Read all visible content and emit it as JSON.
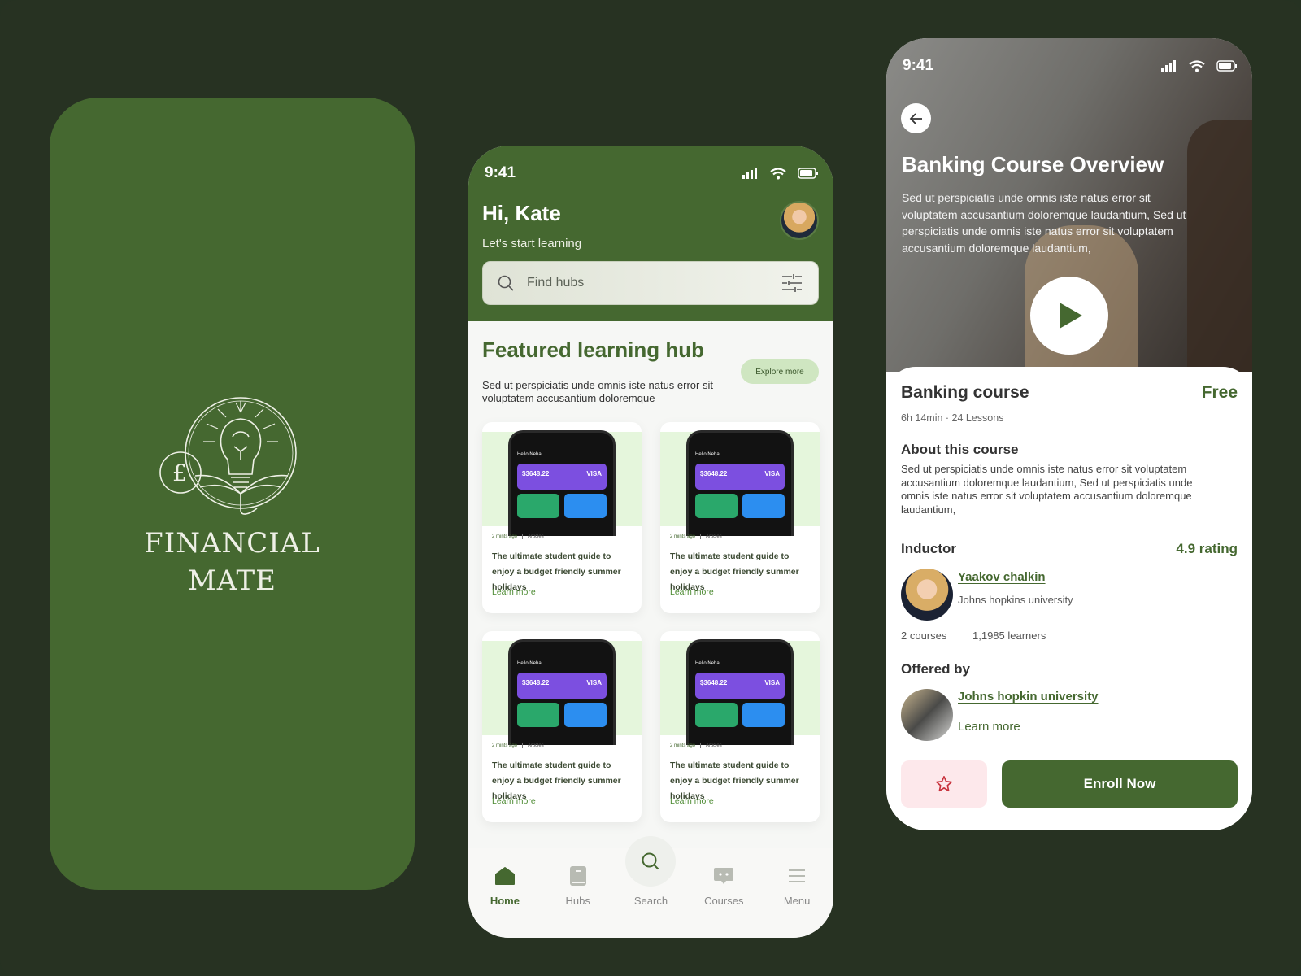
{
  "splash": {
    "brand_line1": "FINANCIAL",
    "brand_line2": "MATE",
    "logo": "lightbulb-book-pound-logo",
    "bg_color": "#456830"
  },
  "home": {
    "status": {
      "time": "9:41"
    },
    "greeting": "Hi, Kate",
    "subtitle": "Let's start learning",
    "search": {
      "placeholder": "Find hubs"
    },
    "featured": {
      "title": "Featured learning hub",
      "explore_label": "Explore more",
      "description": "Sed ut perspiciatis unde omnis iste natus error sit voluptatem accusantium doloremque"
    },
    "cards": [
      {
        "time": "2 mints ago",
        "category": "Articles",
        "title": "The ultimate student guide to enjoy a budget friendly summer holidays",
        "link": "Learn more",
        "mock_greeting": "Hello Nehal",
        "mock_balance": "$3648.22",
        "mock_card": "VISA"
      },
      {
        "time": "2 mints ago",
        "category": "Articles",
        "title": "The ultimate student guide to enjoy a budget friendly summer holidays",
        "link": "Learn more",
        "mock_greeting": "Hello Nehal",
        "mock_balance": "$3648.22",
        "mock_card": "VISA"
      },
      {
        "time": "2 mints ago",
        "category": "Articles",
        "title": "The ultimate student guide to enjoy a budget friendly summer holidays",
        "link": "Learn more",
        "mock_greeting": "Hello Nehal",
        "mock_balance": "$3648.22",
        "mock_card": "VISA"
      },
      {
        "time": "2 mints ago",
        "category": "Articles",
        "title": "The ultimate student guide to enjoy a budget friendly summer holidays",
        "link": "Learn more",
        "mock_greeting": "Hello Nehal",
        "mock_balance": "$3648.22",
        "mock_card": "VISA"
      }
    ],
    "nav": [
      {
        "label": "Home",
        "icon": "home-icon",
        "active": true
      },
      {
        "label": "Hubs",
        "icon": "book-icon",
        "active": false
      },
      {
        "label": "Search",
        "icon": "search-icon",
        "active": false
      },
      {
        "label": "Courses",
        "icon": "chat-icon",
        "active": false
      },
      {
        "label": "Menu",
        "icon": "menu-icon",
        "active": false
      }
    ]
  },
  "detail": {
    "status": {
      "time": "9:41"
    },
    "hero_title": "Banking Course Overview",
    "hero_description": "Sed ut perspiciatis unde omnis iste natus error sit voluptatem accusantium doloremque laudantium, Sed ut perspiciatis unde omnis iste natus error sit voluptatem accusantium doloremque laudantium,",
    "course_title": "Banking course",
    "price": "Free",
    "meta": "6h 14min · 24 Lessons",
    "about_heading": "About this course",
    "about_text": "Sed ut perspiciatis unde omnis iste natus error sit voluptatem accusantium doloremque laudantium, Sed ut perspiciatis unde omnis iste natus error sit voluptatem accusantium doloremque laudantium,",
    "instructor_heading": "Inductor",
    "rating": "4.9 rating",
    "instructor_name": "Yaakov chalkin",
    "instructor_org": "Johns hopkins university",
    "courses_count": "2 courses",
    "learners_count": "1,1985 learners",
    "offered_heading": "Offered by",
    "offered_name": "Johns hopkin university",
    "offered_link": "Learn more",
    "enroll_label": "Enroll Now"
  },
  "colors": {
    "brand": "#456830",
    "background": "#273222",
    "favorite_bg": "#fde8eb",
    "favorite_icon": "#c8323c",
    "light_green": "#cfe6c1"
  }
}
